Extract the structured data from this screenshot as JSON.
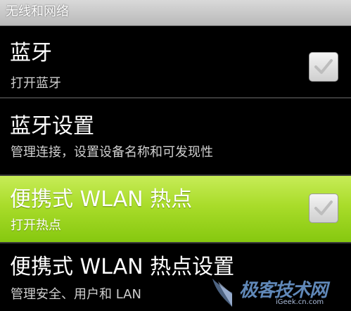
{
  "section": {
    "header": "无线和网络"
  },
  "rows": [
    {
      "title": "蓝牙",
      "summary": "打开蓝牙",
      "checkbox_checked": true
    },
    {
      "title": "蓝牙设置",
      "summary": "管理连接，设置设备名称和可发现性"
    },
    {
      "title": "便携式 WLAN 热点",
      "summary": "打开热点",
      "checkbox_checked": true,
      "highlighted": true
    },
    {
      "title": "便携式 WLAN 热点设置",
      "summary": "管理安全、用户和 LAN"
    }
  ],
  "watermark": {
    "name": "极客技术网",
    "url": "iGeek.cn.com"
  },
  "colors": {
    "background": "#000000",
    "highlight": "#a9dc2a",
    "header": "#c8c8c8"
  }
}
